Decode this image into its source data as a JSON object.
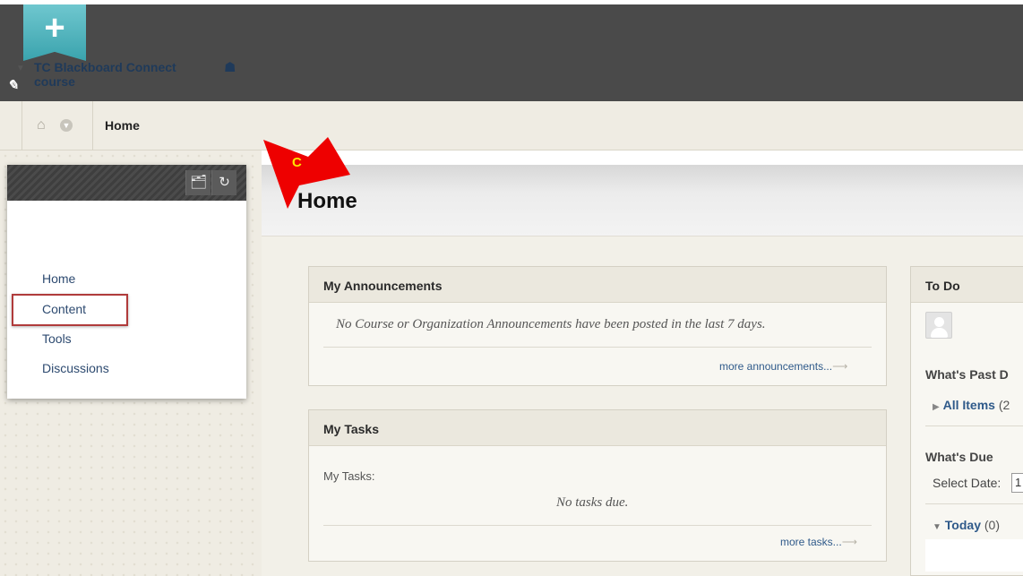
{
  "topbar": {
    "plus_icon": "plus-icon",
    "edit_icon": "pencil-icon",
    "edit_glyph": "✎"
  },
  "breadcrumb": {
    "home_icon": "house-icon",
    "chevron_icon": "chevron-down-icon",
    "label": "Home"
  },
  "course_menu": {
    "title": "TC Blackboard Connect course",
    "items": [
      "Home",
      "Content",
      "Tools",
      "Discussions"
    ],
    "highlighted_item": "Content"
  },
  "annotation": {
    "letter": "C",
    "color": "#ee0000",
    "letter_color": "#ffe600"
  },
  "page": {
    "title": "Home"
  },
  "announcements": {
    "title": "My Announcements",
    "message": "No Course or Organization Announcements have been posted in the last 7 days.",
    "more_link": "more announcements...",
    "arrow": "⟶"
  },
  "tasks": {
    "title": "My Tasks",
    "label": "My Tasks:",
    "message": "No tasks due.",
    "more_link": "more tasks...",
    "arrow": "⟶"
  },
  "todo": {
    "title": "To Do",
    "past_due": "What's Past D",
    "all_items_label": "All Items",
    "all_items_count": "(2",
    "whats_due": "What's Due",
    "select_date": "Select Date:",
    "date_value": "1",
    "today_label": "Today",
    "today_count": "(0)"
  },
  "colors": {
    "link": "#2f5a8a",
    "course_title": "#1f3a5a",
    "highlight_border": "#b03b3b",
    "ribbon": "#3aa3ad"
  }
}
